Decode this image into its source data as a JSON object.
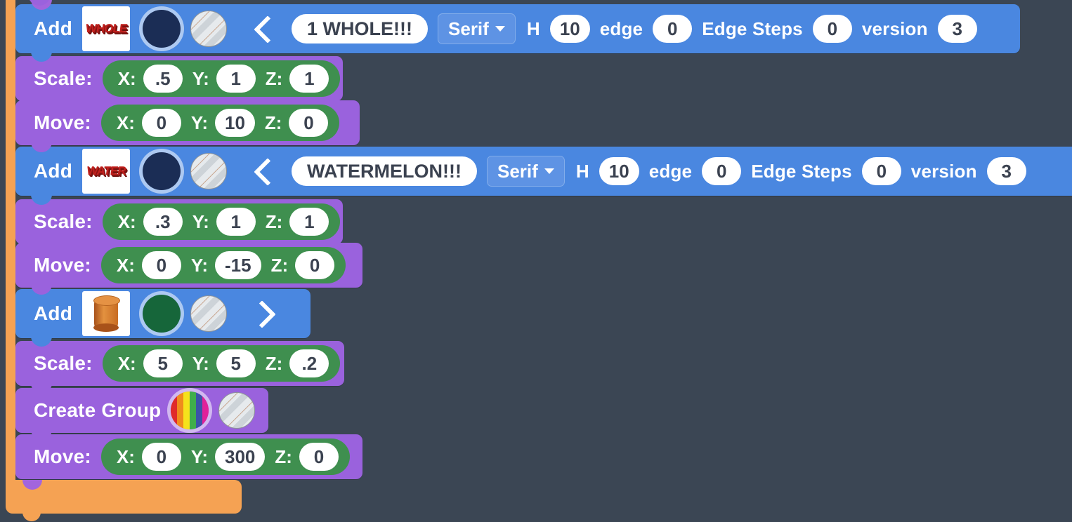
{
  "theme": {
    "canvas_bg": "#3b4654",
    "container_block": "#f5a253",
    "add_block": "#4a87e0",
    "transform_block": "#9a62dd",
    "value_slot": "#3f8f4f",
    "field_bg": "#ffffff",
    "field_text": "#3b4250"
  },
  "blocks": [
    {
      "id": "add-text-whole",
      "type": "add",
      "label": "Add",
      "thumbnail": "text-3d-thumbnail",
      "thumbnail_text": "WHOLE",
      "color_swatch": "#1b2d55",
      "color_name": "navy",
      "texture": "striped-texture-swatch",
      "chevron": "chevron-left-icon",
      "chevron_direction": "left",
      "text_value": "1 WHOLE!!!",
      "font": "Serif",
      "params": [
        {
          "label": "H",
          "value": "10"
        },
        {
          "label": "edge",
          "value": "0"
        },
        {
          "label": "Edge Steps",
          "value": "0"
        },
        {
          "label": "version",
          "value": "3"
        }
      ]
    },
    {
      "id": "scale-1",
      "type": "transform",
      "label": "Scale:",
      "axes": [
        {
          "axis": "X:",
          "value": ".5"
        },
        {
          "axis": "Y:",
          "value": "1"
        },
        {
          "axis": "Z:",
          "value": "1"
        }
      ]
    },
    {
      "id": "move-1",
      "type": "transform",
      "label": "Move:",
      "axes": [
        {
          "axis": "X:",
          "value": "0"
        },
        {
          "axis": "Y:",
          "value": "10"
        },
        {
          "axis": "Z:",
          "value": "0"
        }
      ]
    },
    {
      "id": "add-text-watermelon",
      "type": "add",
      "label": "Add",
      "thumbnail": "text-3d-thumbnail",
      "thumbnail_text": "WATER",
      "color_swatch": "#1b2d55",
      "color_name": "navy",
      "texture": "striped-texture-swatch",
      "chevron": "chevron-left-icon",
      "chevron_direction": "left",
      "text_value": "WATERMELON!!!",
      "font": "Serif",
      "params": [
        {
          "label": "H",
          "value": "10"
        },
        {
          "label": "edge",
          "value": "0"
        },
        {
          "label": "Edge Steps",
          "value": "0"
        },
        {
          "label": "version",
          "value": "3"
        }
      ]
    },
    {
      "id": "scale-2",
      "type": "transform",
      "label": "Scale:",
      "axes": [
        {
          "axis": "X:",
          "value": ".3"
        },
        {
          "axis": "Y:",
          "value": "1"
        },
        {
          "axis": "Z:",
          "value": "1"
        }
      ]
    },
    {
      "id": "move-2",
      "type": "transform",
      "label": "Move:",
      "axes": [
        {
          "axis": "X:",
          "value": "0"
        },
        {
          "axis": "Y:",
          "value": "-15"
        },
        {
          "axis": "Z:",
          "value": "0"
        }
      ]
    },
    {
      "id": "add-cylinder",
      "type": "add",
      "label": "Add",
      "thumbnail": "cylinder-thumbnail",
      "color_swatch": "#16663a",
      "color_name": "green",
      "texture": "striped-texture-swatch",
      "chevron": "chevron-right-icon",
      "chevron_direction": "right"
    },
    {
      "id": "scale-3",
      "type": "transform",
      "label": "Scale:",
      "axes": [
        {
          "axis": "X:",
          "value": "5"
        },
        {
          "axis": "Y:",
          "value": "5"
        },
        {
          "axis": "Z:",
          "value": ".2"
        }
      ]
    },
    {
      "id": "create-group",
      "type": "group",
      "label": "Create Group",
      "color_swatch": "rainbow",
      "rainbow_stops": [
        "#e02a2a",
        "#ef8b1d",
        "#f5e21c",
        "#3fae4a",
        "#3b53a8",
        "#e0219a"
      ],
      "texture": "striped-texture-swatch"
    },
    {
      "id": "move-3",
      "type": "transform",
      "label": "Move:",
      "axes": [
        {
          "axis": "X:",
          "value": "0"
        },
        {
          "axis": "Y:",
          "value": "300"
        },
        {
          "axis": "Z:",
          "value": "0"
        }
      ]
    }
  ]
}
